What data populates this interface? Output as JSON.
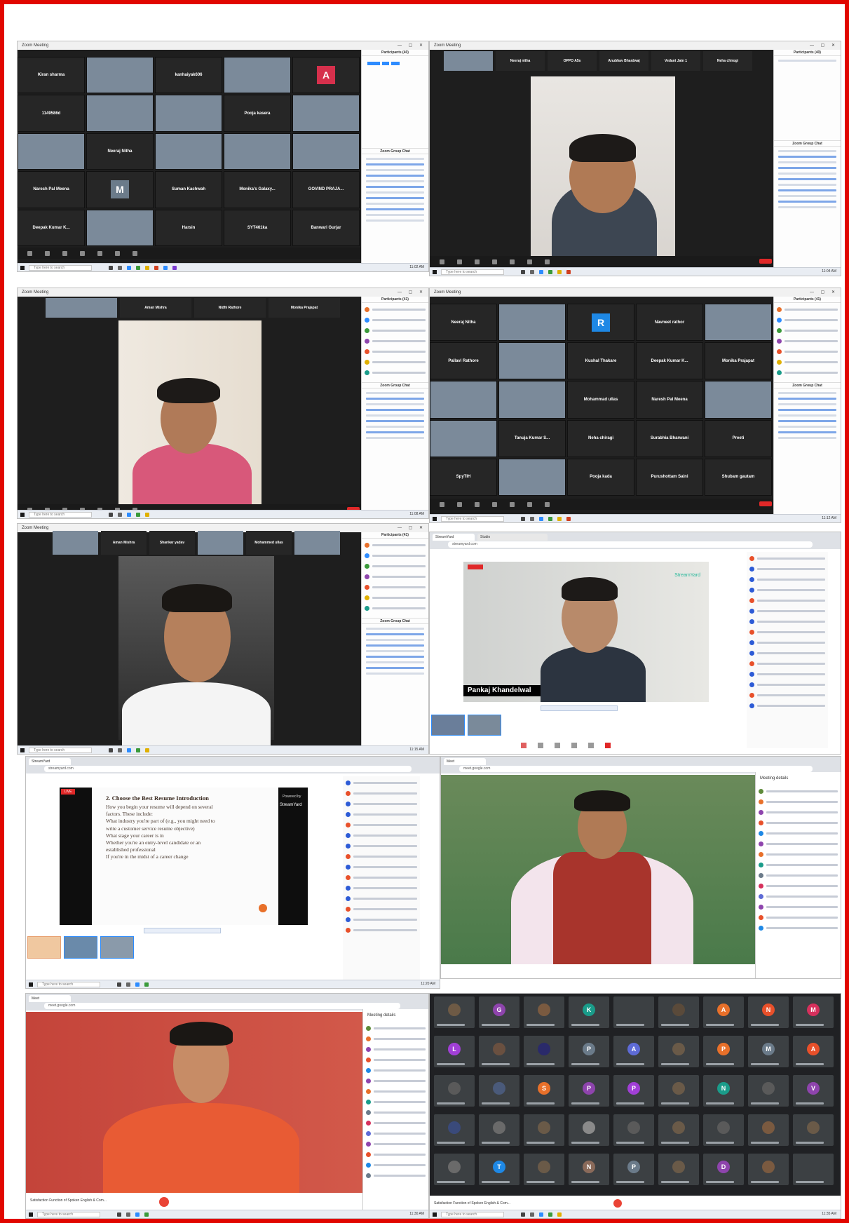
{
  "common": {
    "window_title": "Zoom Meeting",
    "taskbar_search": "Type here to search"
  },
  "shot1": {
    "panel_title": "Participants (40)",
    "chat_title": "Zoom Group Chat",
    "tiles": [
      {
        "label": "Kiran sharma",
        "kind": "name"
      },
      {
        "label": "",
        "kind": "video"
      },
      {
        "label": "kanhaiyak606",
        "kind": "name"
      },
      {
        "label": "",
        "kind": "video"
      },
      {
        "label": "A",
        "kind": "avatar",
        "color": "#d6304c"
      },
      {
        "label": "1149586d",
        "kind": "name"
      },
      {
        "label": "",
        "kind": "video"
      },
      {
        "label": "",
        "kind": "video"
      },
      {
        "label": "Pooja kasera",
        "kind": "name"
      },
      {
        "label": "",
        "kind": "video"
      },
      {
        "label": "",
        "kind": "video"
      },
      {
        "label": "Neeraj Nitha",
        "kind": "name"
      },
      {
        "label": "",
        "kind": "video"
      },
      {
        "label": "",
        "kind": "video"
      },
      {
        "label": "",
        "kind": "video"
      },
      {
        "label": "Naresh Pal Meena",
        "kind": "name"
      },
      {
        "label": "M",
        "kind": "avatar",
        "color": "#6b7b8a"
      },
      {
        "label": "Suman Kachwah",
        "kind": "name"
      },
      {
        "label": "Monika's Galaxy...",
        "kind": "name"
      },
      {
        "label": "GOVIND PRAJA...",
        "kind": "name"
      },
      {
        "label": "Deepak Kumar K...",
        "kind": "name"
      },
      {
        "label": "",
        "kind": "video"
      },
      {
        "label": "Harsin",
        "kind": "name"
      },
      {
        "label": "SYT461ka",
        "kind": "name"
      },
      {
        "label": "Banwari Gurjar",
        "kind": "name"
      }
    ]
  },
  "shot2": {
    "top_names": [
      "",
      "Neeraj nitha",
      "OPPO A5s",
      "Anubhav Bhardwaj",
      "Vedant Jain 1",
      "Neha chirogi"
    ],
    "panel_title": "Participants (40)",
    "chat_title": "Zoom Group Chat"
  },
  "shot3": {
    "top_names": [
      "",
      "Aman Mishra",
      "Nidhi Rathore",
      "Monika Prajapat"
    ],
    "panel_title": "Participants (41)",
    "chat_title": "Zoom Group Chat"
  },
  "shot4": {
    "panel_title": "Participants (41)",
    "chat_title": "Zoom Group Chat",
    "tiles": [
      {
        "label": "Neeraj Nitha",
        "kind": "name"
      },
      {
        "label": "",
        "kind": "video"
      },
      {
        "label": "R",
        "kind": "avatar",
        "color": "#1e88e5"
      },
      {
        "label": "Navneet rathor",
        "kind": "name"
      },
      {
        "label": "",
        "kind": "video"
      },
      {
        "label": "Pallavi Rathore",
        "kind": "name"
      },
      {
        "label": "",
        "kind": "video"
      },
      {
        "label": "Kushal Thakare",
        "kind": "name"
      },
      {
        "label": "Deepak Kumar K...",
        "kind": "name"
      },
      {
        "label": "Monika Prajapat",
        "kind": "name"
      },
      {
        "label": "",
        "kind": "video"
      },
      {
        "label": "",
        "kind": "video"
      },
      {
        "label": "Mohammad ullas",
        "kind": "name"
      },
      {
        "label": "Naresh Pal Meena",
        "kind": "name"
      },
      {
        "label": "",
        "kind": "video"
      },
      {
        "label": "",
        "kind": "video"
      },
      {
        "label": "Tanuja Kumar S...",
        "kind": "name"
      },
      {
        "label": "Neha chiragi",
        "kind": "name"
      },
      {
        "label": "Surabhia Bharwani",
        "kind": "name"
      },
      {
        "label": "Preeti",
        "kind": "name"
      },
      {
        "label": "SpyTIH",
        "kind": "name"
      },
      {
        "label": "",
        "kind": "video"
      },
      {
        "label": "Pooja kada",
        "kind": "name"
      },
      {
        "label": "Purushottam Saini",
        "kind": "name"
      },
      {
        "label": "Shubam gautam",
        "kind": "name"
      }
    ]
  },
  "shot5": {
    "top_names": [
      "",
      "Aman Mishra",
      "Shankar yadav",
      "",
      "Mohammed ullas",
      ""
    ],
    "panel_title": "Participants (41)",
    "chat_title": "Zoom Group Chat"
  },
  "shot6": {
    "speaker_name": "Pankaj Khandelwal",
    "brand": "StreamYard",
    "url": "streamyard.com"
  },
  "shot7": {
    "heading": "2. Choose the Best Resume Introduction",
    "lines": [
      "How you begin your resume will depend on several",
      "factors. These include:",
      "What industry you're part of (e.g., you might need to",
      "write a customer service resume objective)",
      "What stage your career is in",
      "Whether you're an entry-level candidate or an",
      "established professional",
      "If you're in the midst of a career change"
    ],
    "brand_top": "Powered by",
    "brand": "StreamYard",
    "live": "LIVE"
  },
  "shot8": {
    "panel_title": "Meeting details",
    "url": "meet.google.com"
  },
  "shot9": {
    "panel_title": "Meeting details",
    "footer": "Satisfaction Function of Spoken English & Com..."
  },
  "shot10": {
    "footer": "Satisfaction Function of Spoken English & Com...",
    "avatars": [
      {
        "l": "",
        "c": "#6e5a45"
      },
      {
        "l": "G",
        "c": "#8e44ad"
      },
      {
        "l": "",
        "c": "#7a5a40"
      },
      {
        "l": "K",
        "c": "#1a9c8a"
      },
      {
        "l": "",
        "c": "#3c4043"
      },
      {
        "l": "",
        "c": "#5a4a3a"
      },
      {
        "l": "A",
        "c": "#e8702a"
      },
      {
        "l": "N",
        "c": "#e8502a"
      },
      {
        "l": "M",
        "c": "#d6305c"
      },
      {
        "l": "L",
        "c": "#a13fd6"
      },
      {
        "l": "",
        "c": "#6a5040"
      },
      {
        "l": "",
        "c": "#2a2a6a"
      },
      {
        "l": "P",
        "c": "#6b7b8a"
      },
      {
        "l": "A",
        "c": "#5e6bd6"
      },
      {
        "l": "",
        "c": "#6a5a48"
      },
      {
        "l": "P",
        "c": "#e8702a"
      },
      {
        "l": "M",
        "c": "#6b7b8a"
      },
      {
        "l": "A",
        "c": "#e8502a"
      },
      {
        "l": "",
        "c": "#5a5a5a"
      },
      {
        "l": "",
        "c": "#4a5a7a"
      },
      {
        "l": "S",
        "c": "#e8702a"
      },
      {
        "l": "P",
        "c": "#8e44ad"
      },
      {
        "l": "P",
        "c": "#a13fd6"
      },
      {
        "l": "",
        "c": "#6a5a48"
      },
      {
        "l": "N",
        "c": "#1a9c8a"
      },
      {
        "l": "",
        "c": "#5a5a5a"
      },
      {
        "l": "V",
        "c": "#8e44ad"
      },
      {
        "l": "",
        "c": "#3a4a7a"
      },
      {
        "l": "",
        "c": "#6a6a6a"
      },
      {
        "l": "",
        "c": "#6a5a48"
      },
      {
        "l": "",
        "c": "#8a8a8a"
      },
      {
        "l": "",
        "c": "#5a5a5a"
      },
      {
        "l": "",
        "c": "#6a5a48"
      },
      {
        "l": "",
        "c": "#5a5a5a"
      },
      {
        "l": "",
        "c": "#7a5a40"
      },
      {
        "l": "",
        "c": "#6a5a48"
      },
      {
        "l": "",
        "c": "#6a6a6a"
      },
      {
        "l": "T",
        "c": "#1e88e5"
      },
      {
        "l": "",
        "c": "#6a5a48"
      },
      {
        "l": "N",
        "c": "#8a6a5a"
      },
      {
        "l": "P",
        "c": "#6b7b8a"
      },
      {
        "l": "",
        "c": "#6a5a48"
      },
      {
        "l": "D",
        "c": "#8e44ad"
      },
      {
        "l": "",
        "c": "#7a5a40"
      },
      {
        "l": "",
        "c": "#3c4043"
      }
    ]
  }
}
